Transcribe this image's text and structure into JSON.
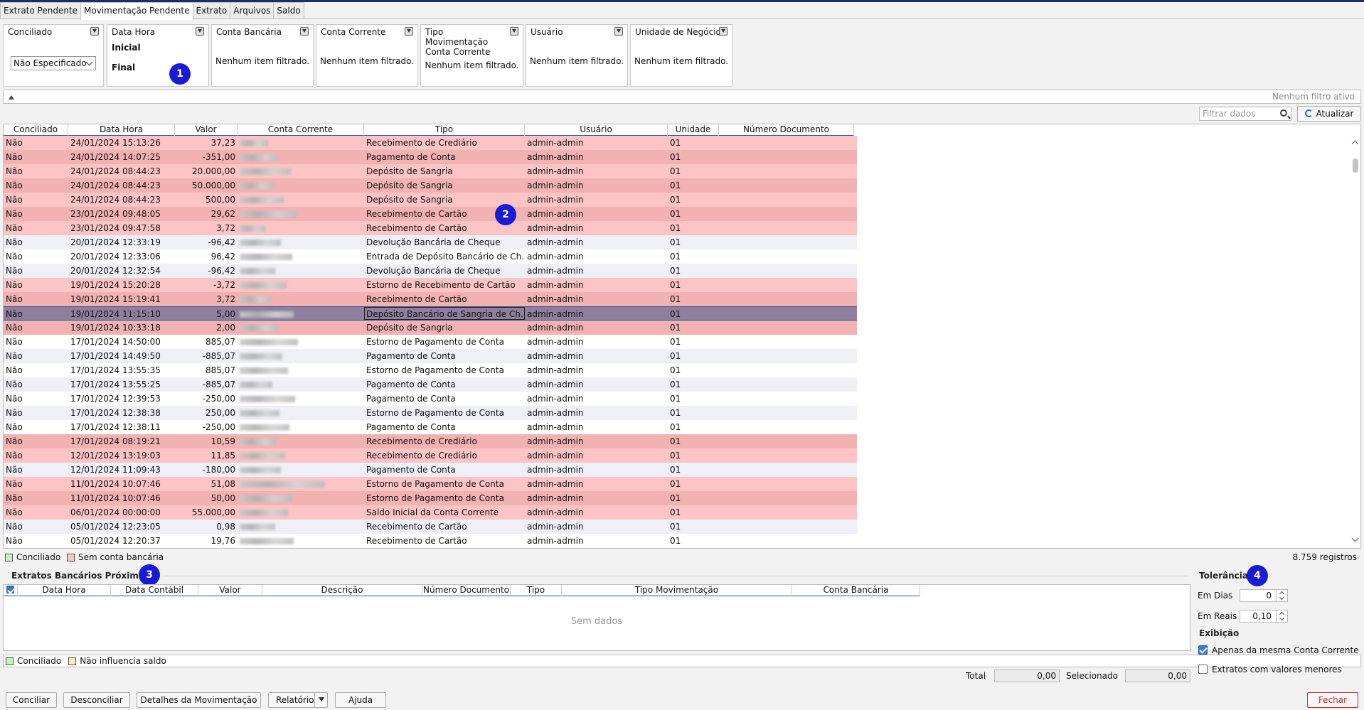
{
  "tabs": [
    "Extrato Pendente",
    "Movimentação Pendente",
    "Extrato",
    "Arquivos",
    "Saldo"
  ],
  "filters": {
    "conciliado": {
      "title": "Conciliado",
      "value": "Não Especificado"
    },
    "data_hora": {
      "title": "Data Hora",
      "inicial": "Inicial",
      "final": "Final"
    },
    "conta_bancaria": {
      "title": "Conta Bancária",
      "empty": "Nenhum item filtrado."
    },
    "conta_corrente": {
      "title": "Conta Corrente",
      "empty": "Nenhum item filtrado."
    },
    "tipo_mov": {
      "title": "Tipo Movimentação Conta Corrente",
      "empty": "Nenhum item filtrado."
    },
    "usuario": {
      "title": "Usuário",
      "empty": "Nenhum item filtrado."
    },
    "unidade": {
      "title": "Unidade de Negócio",
      "empty": "Nenhum item filtrado."
    }
  },
  "badges": [
    "1",
    "2",
    "3",
    "4"
  ],
  "filter_bar": {
    "status": "Nenhum filtro ativo"
  },
  "toolbar": {
    "search_placeholder": "Filtrar dados",
    "refresh": "Atualizar"
  },
  "main_grid": {
    "columns": [
      "Conciliado",
      "Data Hora",
      "Valor",
      "Conta Corrente",
      "Tipo",
      "Usuário",
      "Unidade",
      "Número Documento"
    ],
    "rows": [
      {
        "conc": "Não",
        "dt": "24/01/2024 15:13:26",
        "val": "37,23",
        "tipo": "Recebimento de Crediário",
        "user": "admin-admin",
        "un": "01",
        "style": "pink"
      },
      {
        "conc": "Não",
        "dt": "24/01/2024 14:07:25",
        "val": "-351,00",
        "tipo": "Pagamento de Conta",
        "user": "admin-admin",
        "un": "01",
        "style": "pink"
      },
      {
        "conc": "Não",
        "dt": "24/01/2024 08:44:23",
        "val": "20.000,00",
        "tipo": "Depósito de Sangria",
        "user": "admin-admin",
        "un": "01",
        "style": "pink"
      },
      {
        "conc": "Não",
        "dt": "24/01/2024 08:44:23",
        "val": "50.000,00",
        "tipo": "Depósito de Sangria",
        "user": "admin-admin",
        "un": "01",
        "style": "pink"
      },
      {
        "conc": "Não",
        "dt": "24/01/2024 08:44:23",
        "val": "500,00",
        "tipo": "Depósito de Sangria",
        "user": "admin-admin",
        "un": "01",
        "style": "pink"
      },
      {
        "conc": "Não",
        "dt": "23/01/2024 09:48:05",
        "val": "29,62",
        "tipo": "Recebimento de Cartão",
        "user": "admin-admin",
        "un": "01",
        "style": "pink"
      },
      {
        "conc": "Não",
        "dt": "23/01/2024 09:47:58",
        "val": "3,72",
        "tipo": "Recebimento de Cartão",
        "user": "admin-admin",
        "un": "01",
        "style": "pink"
      },
      {
        "conc": "Não",
        "dt": "20/01/2024 12:33:19",
        "val": "-96,42",
        "tipo": "Devolução Bancária de Cheque",
        "user": "admin-admin",
        "un": "01",
        "style": "white"
      },
      {
        "conc": "Não",
        "dt": "20/01/2024 12:33:06",
        "val": "96,42",
        "tipo": "Entrada de Depósito Bancário de Ch...",
        "user": "admin-admin",
        "un": "01",
        "style": "white"
      },
      {
        "conc": "Não",
        "dt": "20/01/2024 12:32:54",
        "val": "-96,42",
        "tipo": "Devolução Bancária de Cheque",
        "user": "admin-admin",
        "un": "01",
        "style": "white"
      },
      {
        "conc": "Não",
        "dt": "19/01/2024 15:20:28",
        "val": "-3,72",
        "tipo": "Estorno de Recebimento de Cartão",
        "user": "admin-admin",
        "un": "01",
        "style": "pink"
      },
      {
        "conc": "Não",
        "dt": "19/01/2024 15:19:41",
        "val": "3,72",
        "tipo": "Recebimento de Cartão",
        "user": "admin-admin",
        "un": "01",
        "style": "pink"
      },
      {
        "conc": "Não",
        "dt": "19/01/2024 11:15:10",
        "val": "5,00",
        "tipo": "Depósito Bancário de Sangria de Ch...",
        "user": "admin-admin",
        "un": "01",
        "style": "selected"
      },
      {
        "conc": "Não",
        "dt": "19/01/2024 10:33:18",
        "val": "2,00",
        "tipo": "Depósito de Sangria",
        "user": "admin-admin",
        "un": "01",
        "style": "pink"
      },
      {
        "conc": "Não",
        "dt": "17/01/2024 14:50:00",
        "val": "885,07",
        "tipo": "Estorno de Pagamento de Conta",
        "user": "admin-admin",
        "un": "01",
        "style": "white"
      },
      {
        "conc": "Não",
        "dt": "17/01/2024 14:49:50",
        "val": "-885,07",
        "tipo": "Pagamento de Conta",
        "user": "admin-admin",
        "un": "01",
        "style": "white"
      },
      {
        "conc": "Não",
        "dt": "17/01/2024 13:55:35",
        "val": "885,07",
        "tipo": "Estorno de Pagamento de Conta",
        "user": "admin-admin",
        "un": "01",
        "style": "white"
      },
      {
        "conc": "Não",
        "dt": "17/01/2024 13:55:25",
        "val": "-885,07",
        "tipo": "Pagamento de Conta",
        "user": "admin-admin",
        "un": "01",
        "style": "white"
      },
      {
        "conc": "Não",
        "dt": "17/01/2024 12:39:53",
        "val": "-250,00",
        "tipo": "Pagamento de Conta",
        "user": "admin-admin",
        "un": "01",
        "style": "white"
      },
      {
        "conc": "Não",
        "dt": "17/01/2024 12:38:38",
        "val": "250,00",
        "tipo": "Estorno de Pagamento de Conta",
        "user": "admin-admin",
        "un": "01",
        "style": "white"
      },
      {
        "conc": "Não",
        "dt": "17/01/2024 12:38:11",
        "val": "-250,00",
        "tipo": "Pagamento de Conta",
        "user": "admin-admin",
        "un": "01",
        "style": "white"
      },
      {
        "conc": "Não",
        "dt": "17/01/2024 08:19:21",
        "val": "10,59",
        "tipo": "Recebimento de Crediário",
        "user": "admin-admin",
        "un": "01",
        "style": "pink"
      },
      {
        "conc": "Não",
        "dt": "12/01/2024 13:19:03",
        "val": "11,85",
        "tipo": "Recebimento de Crediário",
        "user": "admin-admin",
        "un": "01",
        "style": "pink"
      },
      {
        "conc": "Não",
        "dt": "12/01/2024 11:09:43",
        "val": "-180,00",
        "tipo": "Pagamento de Conta",
        "user": "admin-admin",
        "un": "01",
        "style": "white"
      },
      {
        "conc": "Não",
        "dt": "11/01/2024 10:07:46",
        "val": "51,08",
        "tipo": "Estorno de Pagamento de Conta",
        "user": "admin-admin",
        "un": "01",
        "style": "pink"
      },
      {
        "conc": "Não",
        "dt": "11/01/2024 10:07:46",
        "val": "50,00",
        "tipo": "Estorno de Pagamento de Conta",
        "user": "admin-admin",
        "un": "01",
        "style": "pink"
      },
      {
        "conc": "Não",
        "dt": "06/01/2024 00:00:00",
        "val": "55.000,00",
        "tipo": "Saldo Inicial da Conta Corrente",
        "user": "admin-admin",
        "un": "01",
        "style": "pink"
      },
      {
        "conc": "Não",
        "dt": "05/01/2024 12:23:05",
        "val": "0,98",
        "tipo": "Recebimento de Cartão",
        "user": "admin-admin",
        "un": "01",
        "style": "white"
      },
      {
        "conc": "Não",
        "dt": "05/01/2024 12:20:37",
        "val": "19,76",
        "tipo": "Recebimento de Cartão",
        "user": "admin-admin",
        "un": "01",
        "style": "white"
      }
    ]
  },
  "legend1": {
    "conciliado": "Conciliado",
    "sem_conta": "Sem conta bancária",
    "count": "8.759 registros"
  },
  "extratos": {
    "title": "Extratos Bancários Próximos",
    "columns": [
      "Data Hora",
      "Data Contábil",
      "Valor",
      "Descrição",
      "Número Documento",
      "Tipo",
      "Tipo Movimentação",
      "Conta Bancária"
    ],
    "nodata": "Sem dados"
  },
  "legend2": {
    "conciliado": "Conciliado",
    "nao_influencia": "Não influencia saldo"
  },
  "totals": {
    "total_label": "Total",
    "total_value": "0,00",
    "sel_label": "Selecionado",
    "sel_value": "0,00"
  },
  "tolerancia": {
    "title": "Tolerância",
    "em_dias_label": "Em Dias",
    "em_dias": "0",
    "em_reais_label": "Em Reais",
    "em_reais": "0,10",
    "exibicao": "Exibição",
    "opt1": "Apenas da mesma Conta Corrente",
    "opt2": "Extratos com valores menores"
  },
  "buttons": {
    "conciliar": "Conciliar",
    "desconciliar": "Desconciliar",
    "detalhes": "Detalhes da Movimentação",
    "relatorio": "Relatório",
    "ajuda": "Ajuda",
    "fechar": "Fechar"
  },
  "colors": {
    "pink_row": "#fcc4c4",
    "selected_row": "#8e7f9f",
    "conciliado_swatch": "#c8f0c0",
    "sem_conta_swatch": "#fcc4c4",
    "nao_influencia_swatch": "#f8f0b0",
    "fechar_border": "#c03030"
  }
}
